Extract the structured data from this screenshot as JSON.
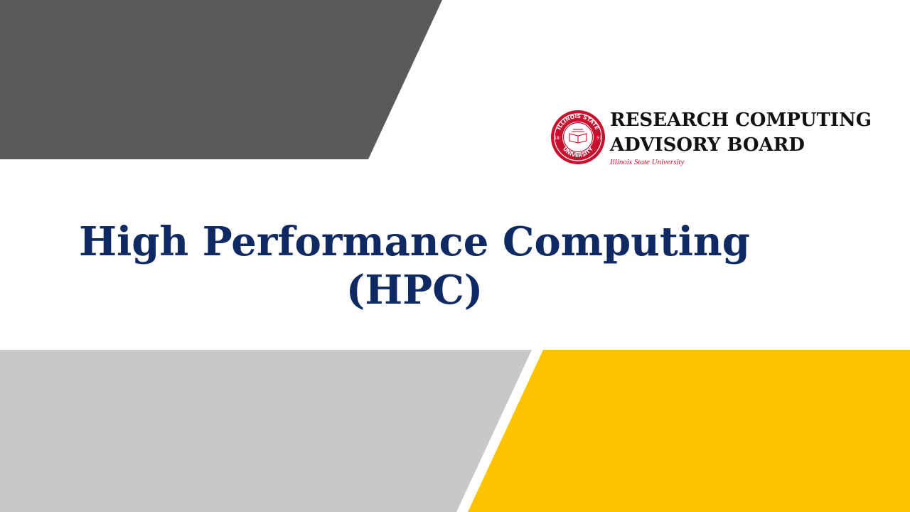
{
  "colors": {
    "dark_gray": "#5a5a5a",
    "light_gray": "#c8c8c8",
    "gold": "#fdc200",
    "title_navy": "#0f2a62",
    "seal_red": "#c8102e"
  },
  "logo": {
    "line1": "RESEARCH COMPUTING",
    "line2": "ADVISORY BOARD",
    "subtitle": "Illinois State University",
    "seal_text_top": "ILLINOIS STATE",
    "seal_text_bottom": "UNIVERSITY",
    "seal_year_left": "18",
    "seal_year_right": "57"
  },
  "title": {
    "line1": "High Performance Computing",
    "line2": "(HPC)"
  }
}
